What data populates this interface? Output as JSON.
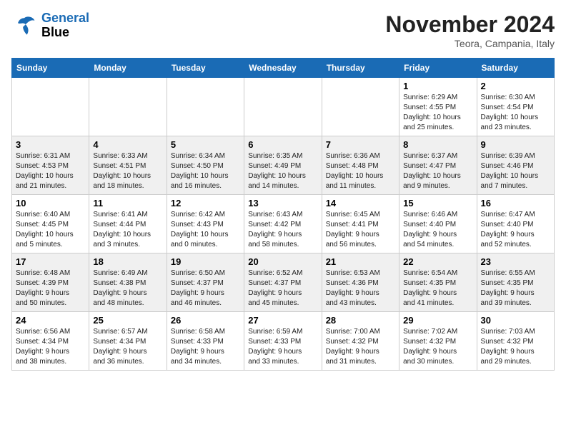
{
  "header": {
    "logo_line1": "General",
    "logo_line2": "Blue",
    "month_title": "November 2024",
    "location": "Teora, Campania, Italy"
  },
  "weekdays": [
    "Sunday",
    "Monday",
    "Tuesday",
    "Wednesday",
    "Thursday",
    "Friday",
    "Saturday"
  ],
  "weeks": [
    [
      {
        "day": "",
        "info": ""
      },
      {
        "day": "",
        "info": ""
      },
      {
        "day": "",
        "info": ""
      },
      {
        "day": "",
        "info": ""
      },
      {
        "day": "",
        "info": ""
      },
      {
        "day": "1",
        "info": "Sunrise: 6:29 AM\nSunset: 4:55 PM\nDaylight: 10 hours\nand 25 minutes."
      },
      {
        "day": "2",
        "info": "Sunrise: 6:30 AM\nSunset: 4:54 PM\nDaylight: 10 hours\nand 23 minutes."
      }
    ],
    [
      {
        "day": "3",
        "info": "Sunrise: 6:31 AM\nSunset: 4:53 PM\nDaylight: 10 hours\nand 21 minutes."
      },
      {
        "day": "4",
        "info": "Sunrise: 6:33 AM\nSunset: 4:51 PM\nDaylight: 10 hours\nand 18 minutes."
      },
      {
        "day": "5",
        "info": "Sunrise: 6:34 AM\nSunset: 4:50 PM\nDaylight: 10 hours\nand 16 minutes."
      },
      {
        "day": "6",
        "info": "Sunrise: 6:35 AM\nSunset: 4:49 PM\nDaylight: 10 hours\nand 14 minutes."
      },
      {
        "day": "7",
        "info": "Sunrise: 6:36 AM\nSunset: 4:48 PM\nDaylight: 10 hours\nand 11 minutes."
      },
      {
        "day": "8",
        "info": "Sunrise: 6:37 AM\nSunset: 4:47 PM\nDaylight: 10 hours\nand 9 minutes."
      },
      {
        "day": "9",
        "info": "Sunrise: 6:39 AM\nSunset: 4:46 PM\nDaylight: 10 hours\nand 7 minutes."
      }
    ],
    [
      {
        "day": "10",
        "info": "Sunrise: 6:40 AM\nSunset: 4:45 PM\nDaylight: 10 hours\nand 5 minutes."
      },
      {
        "day": "11",
        "info": "Sunrise: 6:41 AM\nSunset: 4:44 PM\nDaylight: 10 hours\nand 3 minutes."
      },
      {
        "day": "12",
        "info": "Sunrise: 6:42 AM\nSunset: 4:43 PM\nDaylight: 10 hours\nand 0 minutes."
      },
      {
        "day": "13",
        "info": "Sunrise: 6:43 AM\nSunset: 4:42 PM\nDaylight: 9 hours\nand 58 minutes."
      },
      {
        "day": "14",
        "info": "Sunrise: 6:45 AM\nSunset: 4:41 PM\nDaylight: 9 hours\nand 56 minutes."
      },
      {
        "day": "15",
        "info": "Sunrise: 6:46 AM\nSunset: 4:40 PM\nDaylight: 9 hours\nand 54 minutes."
      },
      {
        "day": "16",
        "info": "Sunrise: 6:47 AM\nSunset: 4:40 PM\nDaylight: 9 hours\nand 52 minutes."
      }
    ],
    [
      {
        "day": "17",
        "info": "Sunrise: 6:48 AM\nSunset: 4:39 PM\nDaylight: 9 hours\nand 50 minutes."
      },
      {
        "day": "18",
        "info": "Sunrise: 6:49 AM\nSunset: 4:38 PM\nDaylight: 9 hours\nand 48 minutes."
      },
      {
        "day": "19",
        "info": "Sunrise: 6:50 AM\nSunset: 4:37 PM\nDaylight: 9 hours\nand 46 minutes."
      },
      {
        "day": "20",
        "info": "Sunrise: 6:52 AM\nSunset: 4:37 PM\nDaylight: 9 hours\nand 45 minutes."
      },
      {
        "day": "21",
        "info": "Sunrise: 6:53 AM\nSunset: 4:36 PM\nDaylight: 9 hours\nand 43 minutes."
      },
      {
        "day": "22",
        "info": "Sunrise: 6:54 AM\nSunset: 4:35 PM\nDaylight: 9 hours\nand 41 minutes."
      },
      {
        "day": "23",
        "info": "Sunrise: 6:55 AM\nSunset: 4:35 PM\nDaylight: 9 hours\nand 39 minutes."
      }
    ],
    [
      {
        "day": "24",
        "info": "Sunrise: 6:56 AM\nSunset: 4:34 PM\nDaylight: 9 hours\nand 38 minutes."
      },
      {
        "day": "25",
        "info": "Sunrise: 6:57 AM\nSunset: 4:34 PM\nDaylight: 9 hours\nand 36 minutes."
      },
      {
        "day": "26",
        "info": "Sunrise: 6:58 AM\nSunset: 4:33 PM\nDaylight: 9 hours\nand 34 minutes."
      },
      {
        "day": "27",
        "info": "Sunrise: 6:59 AM\nSunset: 4:33 PM\nDaylight: 9 hours\nand 33 minutes."
      },
      {
        "day": "28",
        "info": "Sunrise: 7:00 AM\nSunset: 4:32 PM\nDaylight: 9 hours\nand 31 minutes."
      },
      {
        "day": "29",
        "info": "Sunrise: 7:02 AM\nSunset: 4:32 PM\nDaylight: 9 hours\nand 30 minutes."
      },
      {
        "day": "30",
        "info": "Sunrise: 7:03 AM\nSunset: 4:32 PM\nDaylight: 9 hours\nand 29 minutes."
      }
    ]
  ]
}
